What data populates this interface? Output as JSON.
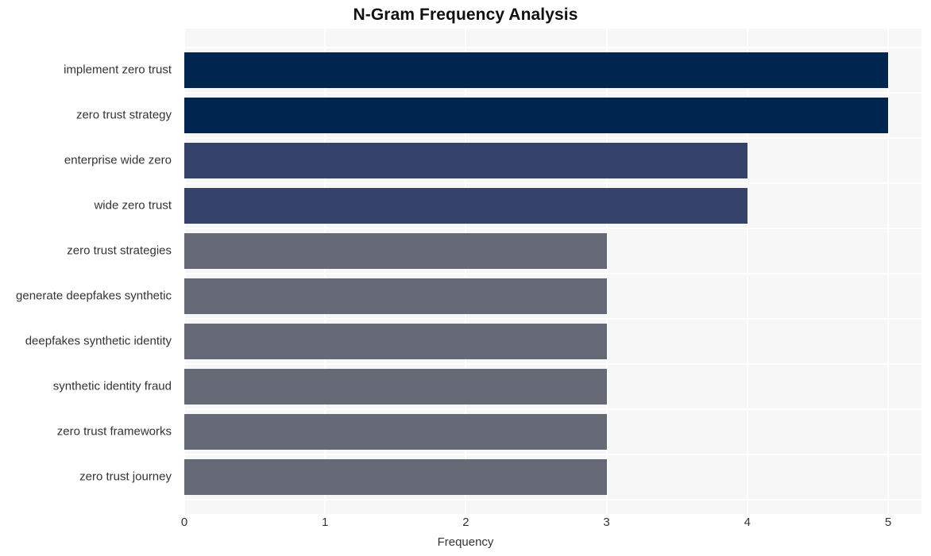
{
  "chart_data": {
    "type": "bar",
    "orientation": "horizontal",
    "title": "N-Gram Frequency Analysis",
    "xlabel": "Frequency",
    "ylabel": "",
    "xlim": [
      0,
      5
    ],
    "xticks": [
      "0",
      "1",
      "2",
      "3",
      "4",
      "5"
    ],
    "grid": true,
    "legend": null,
    "categories": [
      "implement zero trust",
      "zero trust strategy",
      "enterprise wide zero",
      "wide zero trust",
      "zero trust strategies",
      "generate deepfakes synthetic",
      "deepfakes synthetic identity",
      "synthetic identity fraud",
      "zero trust frameworks",
      "zero trust journey"
    ],
    "values": [
      5,
      5,
      4,
      4,
      3,
      3,
      3,
      3,
      3,
      3
    ],
    "bar_colors": [
      "#00264f",
      "#00264f",
      "#35436b",
      "#35436b",
      "#666a76",
      "#666a76",
      "#666a76",
      "#666a76",
      "#666a76",
      "#666a76"
    ]
  },
  "style": {
    "plot_background": "#f7f7f7",
    "page_background": "#ffffff",
    "gridline_color": "#ffffff",
    "tick_label_color": "#333333",
    "title_color": "#111111"
  }
}
